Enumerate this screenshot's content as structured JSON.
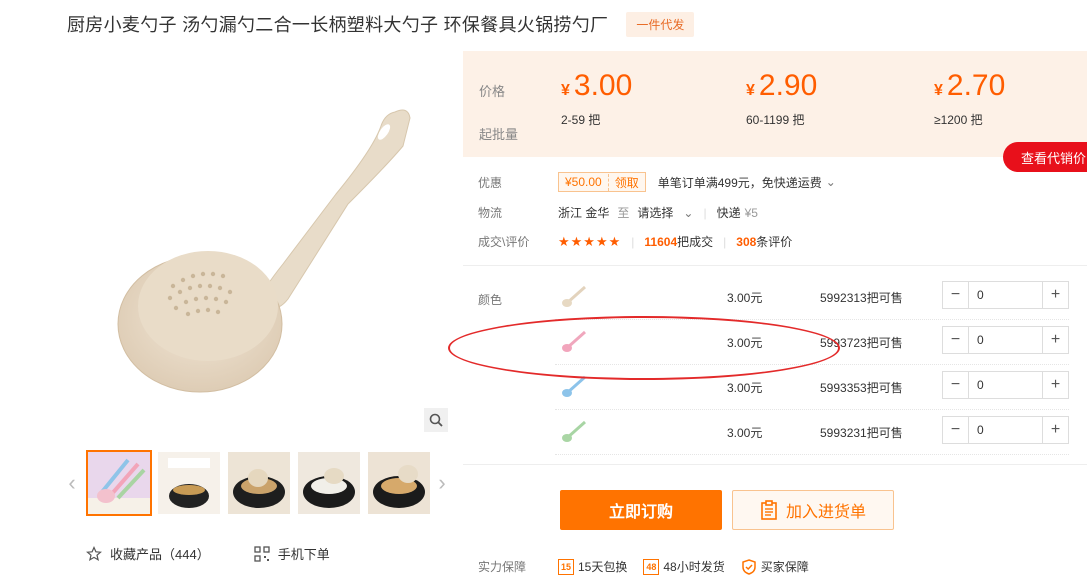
{
  "product": {
    "title": "厨房小麦勺子 汤勺漏勺二合一长柄塑料大勺子 环保餐具火锅捞勺厂",
    "badge": "一件代发"
  },
  "gallery": {
    "main_image_alt": "wheat-straw ladle",
    "thumbnails": [
      "thumb-1",
      "thumb-2",
      "thumb-3",
      "thumb-4",
      "thumb-5"
    ],
    "favorite_label": "收藏产品（444）",
    "mobile_order_label": "手机下单"
  },
  "pricing": {
    "price_label": "价格",
    "min_qty_label": "起批量",
    "currency": "¥",
    "tiers": [
      {
        "price": "3.00",
        "qty": "2-59 把"
      },
      {
        "price": "2.90",
        "qty": "60-1199 把"
      },
      {
        "price": "2.70",
        "qty": "≥1200 把"
      }
    ],
    "agent_price_btn": "查看代销价"
  },
  "promo": {
    "label": "优惠",
    "coupon_value": "¥50.00",
    "coupon_action": "领取",
    "desc": "单笔订单满499元，免快递运费"
  },
  "logistics": {
    "label": "物流",
    "from": "浙江 金华",
    "to_word": "至",
    "dest": "请选择",
    "method": "快递",
    "fee": "¥5"
  },
  "deals": {
    "label": "成交\\评价",
    "stars": "★★★★★",
    "deal_count": "11604",
    "deal_suffix": "把成交",
    "review_count": "308",
    "review_suffix": "条评价"
  },
  "sku": {
    "label": "颜色",
    "rows": [
      {
        "price": "3.00元",
        "stock": "5992313把可售",
        "qty": "0"
      },
      {
        "price": "3.00元",
        "stock": "5993723把可售",
        "qty": "0"
      },
      {
        "price": "3.00元",
        "stock": "5993353把可售",
        "qty": "0"
      },
      {
        "price": "3.00元",
        "stock": "5993231把可售",
        "qty": "0"
      }
    ]
  },
  "actions": {
    "buy_now": "立即订购",
    "add_to_cart": "加入进货单"
  },
  "guarantee": {
    "label": "实力保障",
    "items": [
      {
        "icon_text": "15",
        "label": "15天包换"
      },
      {
        "icon_text": "48",
        "label": "48小时发货"
      },
      {
        "icon_text": "",
        "label": "买家保障"
      }
    ]
  },
  "colors": {
    "accent": "#ff7300",
    "price": "#ff5d00",
    "agent_red": "#e8101b",
    "price_bg": "#fdf1e7"
  }
}
